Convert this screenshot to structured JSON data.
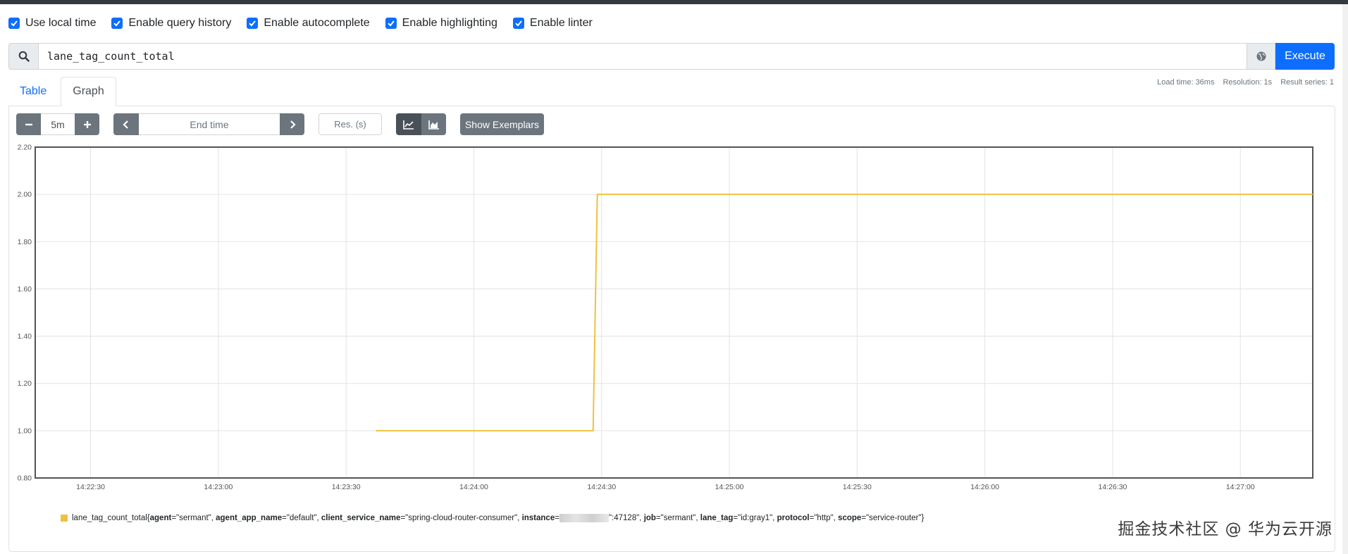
{
  "options": [
    {
      "label": "Use local time",
      "checked": true
    },
    {
      "label": "Enable query history",
      "checked": true
    },
    {
      "label": "Enable autocomplete",
      "checked": true
    },
    {
      "label": "Enable highlighting",
      "checked": true
    },
    {
      "label": "Enable linter",
      "checked": true
    }
  ],
  "query": {
    "value": "lane_tag_count_total",
    "search_icon": "search-icon",
    "metrics_icon": "globe-icon",
    "execute_label": "Execute"
  },
  "tabs": {
    "table": "Table",
    "graph": "Graph",
    "active": "Graph"
  },
  "stats": {
    "load_time": "Load time: 36ms",
    "resolution": "Resolution: 1s",
    "result_series": "Result series: 1"
  },
  "controls": {
    "range_minus": "−",
    "range_value": "5m",
    "range_plus": "+",
    "end_time_placeholder": "End time",
    "res_placeholder": "Res. (s)",
    "stacked_line_icon": "line-chart-icon",
    "stacked_area_icon": "area-chart-icon",
    "exemplars_label": "Show Exemplars"
  },
  "chart_data": {
    "type": "line",
    "title": "",
    "xlabel": "",
    "ylabel": "",
    "ylim": [
      0.8,
      2.2
    ],
    "yticks": [
      "0.80",
      "1.00",
      "1.20",
      "1.40",
      "1.60",
      "1.80",
      "2.00",
      "2.20"
    ],
    "xlim": [
      "14:22:17",
      "14:27:17"
    ],
    "xticks": [
      "14:22:30",
      "14:23:00",
      "14:23:30",
      "14:24:00",
      "14:24:30",
      "14:25:00",
      "14:25:30",
      "14:26:00",
      "14:26:30",
      "14:27:00"
    ],
    "grid": true,
    "legend_position": "bottom",
    "series": [
      {
        "color": "#edc240",
        "points": [
          [
            "14:23:37",
            1.0
          ],
          [
            "14:24:28",
            1.0
          ],
          [
            "14:24:29",
            2.0
          ],
          [
            "14:27:17",
            2.0
          ]
        ]
      }
    ]
  },
  "legend": {
    "metric": "lane_tag_count_total",
    "labels": [
      {
        "key": "agent",
        "value": "\"sermant\""
      },
      {
        "key": "agent_app_name",
        "value": "\"default\""
      },
      {
        "key": "client_service_name",
        "value": "\"spring-cloud-router-consumer\""
      },
      {
        "key": "instance",
        "value": "\":47128\""
      },
      {
        "key": "job",
        "value": "\"sermant\""
      },
      {
        "key": "lane_tag",
        "value": "\"id:gray1\""
      },
      {
        "key": "protocol",
        "value": "\"http\""
      },
      {
        "key": "scope",
        "value": "\"service-router\""
      }
    ]
  },
  "watermark": "掘金技术社区 @ 华为云开源"
}
